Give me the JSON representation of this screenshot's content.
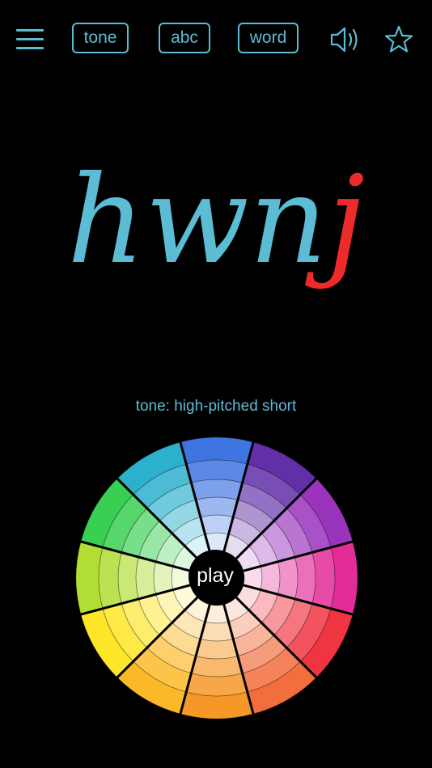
{
  "toolbar": {
    "menu_icon": "hamburger-menu-icon",
    "tone_label": "tone",
    "abc_label": "abc",
    "word_label": "word",
    "speaker_icon": "speaker-icon",
    "star_icon": "star-icon",
    "accent_color": "#5bbcd4"
  },
  "main": {
    "word_prefix": "hwn",
    "word_last": "j",
    "word_color": "#5bbcd4",
    "highlight_color": "#ee2b2b",
    "tone_label": "tone: high-pitched short",
    "play_label": "play"
  },
  "wheel": {
    "segments": [
      {
        "name": "blue",
        "color": "#2462dc"
      },
      {
        "name": "indigo",
        "color": "#4b139c"
      },
      {
        "name": "violet",
        "color": "#8c18b4"
      },
      {
        "name": "magenta",
        "color": "#de0f8a"
      },
      {
        "name": "red",
        "color": "#ee1a28"
      },
      {
        "name": "red-orange",
        "color": "#f05a22"
      },
      {
        "name": "orange",
        "color": "#f48a0a"
      },
      {
        "name": "yellow-orange",
        "color": "#fbb00c"
      },
      {
        "name": "yellow",
        "color": "#fde10a"
      },
      {
        "name": "yellow-green",
        "color": "#a6d818"
      },
      {
        "name": "green",
        "color": "#1ec83a"
      },
      {
        "name": "cyan",
        "color": "#0fa6c6"
      }
    ]
  }
}
